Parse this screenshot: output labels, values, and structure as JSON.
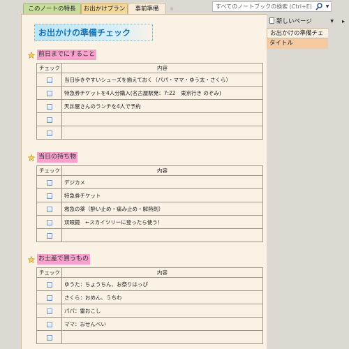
{
  "tabs": [
    {
      "label": "このノートの特長"
    },
    {
      "label": "お出かけプラン"
    },
    {
      "label": "事前準備"
    }
  ],
  "new_tab_glyph": "☼",
  "search": {
    "placeholder": "すべてのノートブックの検索 (Ctrl+E)",
    "icon": "search-icon"
  },
  "page_title": "お出かけの準備チェック",
  "table_headers": {
    "check": "チェック",
    "content": "内容"
  },
  "sections": [
    {
      "title": "前日までにすること",
      "rows": [
        "当日歩きやすいシューズを揃えておく（パパ・ママ・ゆう太・さくら）",
        "特急券チケットを4人分購入(名古屋駅発：7:22　東京行き のぞみ)",
        "天丼屋さんのランチを4人で予約",
        "",
        ""
      ]
    },
    {
      "title": "当日の持ち物",
      "rows": [
        "デジカメ",
        "特急券チケット",
        "救急の薬（酔い止め・痛み止め・解熱剤）",
        "双眼鏡　←スカイツリーに登ったら使う！",
        ""
      ]
    },
    {
      "title": "お土産で買うもの",
      "rows": [
        "ゆうた：ちょうちん、お祭りはっぴ",
        "さくら：おめん、うちわ",
        "パパ：雷おこし",
        "ママ：おせんべい",
        ""
      ]
    }
  ],
  "right_panel": {
    "new_page_label": "新しいページ",
    "pages": [
      "お出かけの準備チェ",
      "タイトル"
    ]
  },
  "colors": {
    "page_bg": "#fbf2e6",
    "title_text": "#1673b8",
    "section_highlight": "#f7a1cc",
    "star": "#d9a521",
    "selected_page": "#f5c9a2"
  }
}
